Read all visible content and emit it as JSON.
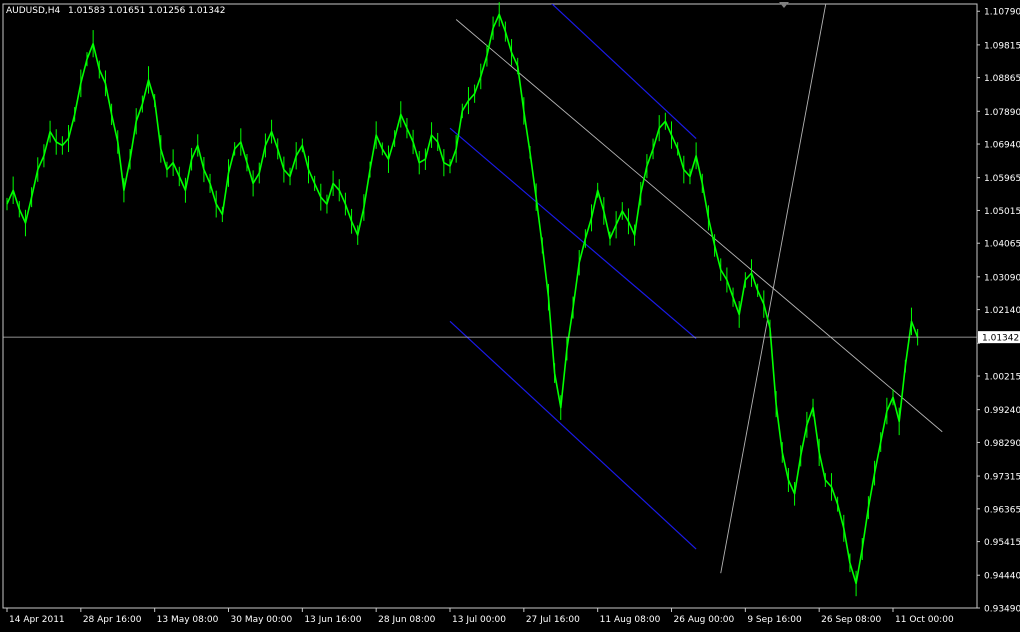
{
  "header": {
    "symbol_label": "AUDUSD,H4",
    "ohlc_label": "1.01583 1.01651 1.01256 1.01342"
  },
  "current_price_label": "1.01342",
  "colors": {
    "background": "#000000",
    "frame": "#c8c8c8",
    "candles": "#00ff00",
    "channel": "#1a1ae6",
    "trendline": "#b4b4b4",
    "price_line": "#c0c0c0",
    "text": "#ffffff"
  },
  "chart_data": {
    "type": "line",
    "title": "AUDUSD,H4",
    "xlabel": "",
    "ylabel": "",
    "ylim": [
      0.9349,
      1.11
    ],
    "grid": false,
    "y_ticks": [
      1.1079,
      1.09815,
      1.08865,
      1.0789,
      1.0694,
      1.05965,
      1.05015,
      1.04065,
      1.0309,
      1.0214,
      1.01165,
      1.00215,
      0.9924,
      0.9829,
      0.97315,
      0.96365,
      0.95415,
      0.9444,
      0.9349
    ],
    "y_tick_labels": [
      "1.10790",
      "1.09815",
      "1.08865",
      "1.07890",
      "1.06940",
      "1.05965",
      "1.05015",
      "1.04065",
      "1.03090",
      "1.02140",
      "1.01165",
      "1.00215",
      "0.99240",
      "0.98290",
      "0.97315",
      "0.96365",
      "0.95415",
      "0.94440",
      "0.93490"
    ],
    "x_tick_labels": [
      "14 Apr 2011",
      "28 Apr 16:00",
      "13 May 08:00",
      "30 May 00:00",
      "13 Jun 16:00",
      "28 Jun 08:00",
      "13 Jul 00:00",
      "27 Jul 16:00",
      "11 Aug 08:00",
      "26 Aug 00:00",
      "9 Sep 16:00",
      "26 Sep 08:00",
      "11 Oct 00:00"
    ],
    "x_tick_index": [
      0,
      12,
      24,
      36,
      48,
      60,
      72,
      84,
      96,
      108,
      120,
      132,
      144
    ],
    "x_count": 158,
    "current_price": 1.01342,
    "series": [
      {
        "values": [
          1.052,
          1.056,
          1.0505,
          1.0465,
          1.054,
          1.062,
          1.066,
          1.073,
          1.07,
          1.069,
          1.071,
          1.078,
          1.087,
          1.094,
          1.0985,
          1.091,
          1.087,
          1.078,
          1.07,
          1.056,
          1.065,
          1.076,
          1.081,
          1.088,
          1.082,
          1.068,
          1.062,
          1.064,
          1.06,
          1.056,
          1.065,
          1.069,
          1.062,
          1.058,
          1.052,
          1.049,
          1.061,
          1.068,
          1.07,
          1.064,
          1.058,
          1.061,
          1.069,
          1.073,
          1.068,
          1.062,
          1.06,
          1.066,
          1.069,
          1.062,
          1.058,
          1.054,
          1.052,
          1.058,
          1.056,
          1.052,
          1.047,
          1.043,
          1.051,
          1.062,
          1.072,
          1.068,
          1.065,
          1.071,
          1.078,
          1.074,
          1.07,
          1.064,
          1.065,
          1.072,
          1.07,
          1.064,
          1.063,
          1.068,
          1.079,
          1.082,
          1.084,
          1.089,
          1.095,
          1.103,
          1.107,
          1.102,
          1.096,
          1.092,
          1.079,
          1.067,
          1.054,
          1.04,
          1.025,
          1.003,
          0.993,
          1.01,
          1.022,
          1.035,
          1.042,
          1.048,
          1.056,
          1.05,
          1.042,
          1.046,
          1.05,
          1.047,
          1.043,
          1.055,
          1.063,
          1.068,
          1.074,
          1.076,
          1.072,
          1.068,
          1.062,
          1.06,
          1.066,
          1.058,
          1.048,
          1.04,
          1.033,
          1.03,
          1.025,
          1.02,
          1.03,
          1.032,
          1.027,
          1.023,
          1.016,
          0.994,
          0.98,
          0.972,
          0.968,
          0.979,
          0.988,
          0.993,
          0.98,
          0.972,
          0.97,
          0.965,
          0.958,
          0.948,
          0.942,
          0.952,
          0.964,
          0.974,
          0.983,
          0.992,
          0.996,
          0.989,
          1.005,
          1.018,
          1.0134
        ]
      }
    ],
    "drawn_lines": [
      {
        "name": "channel-upper",
        "kind": "channel",
        "from": [
          82,
          1.121
        ],
        "to": [
          112,
          1.071
        ]
      },
      {
        "name": "channel-middle",
        "kind": "channel",
        "from": [
          72,
          1.074
        ],
        "to": [
          112,
          1.013
        ]
      },
      {
        "name": "channel-lower",
        "kind": "channel",
        "from": [
          72,
          1.018
        ],
        "to": [
          112,
          0.952
        ]
      },
      {
        "name": "trendline-descending",
        "kind": "trendline",
        "from": [
          73,
          1.1055
        ],
        "to": [
          152,
          0.986
        ]
      },
      {
        "name": "trendline-steep",
        "kind": "trendline",
        "from": [
          116,
          0.945
        ],
        "to": [
          134,
          1.119
        ]
      }
    ]
  }
}
